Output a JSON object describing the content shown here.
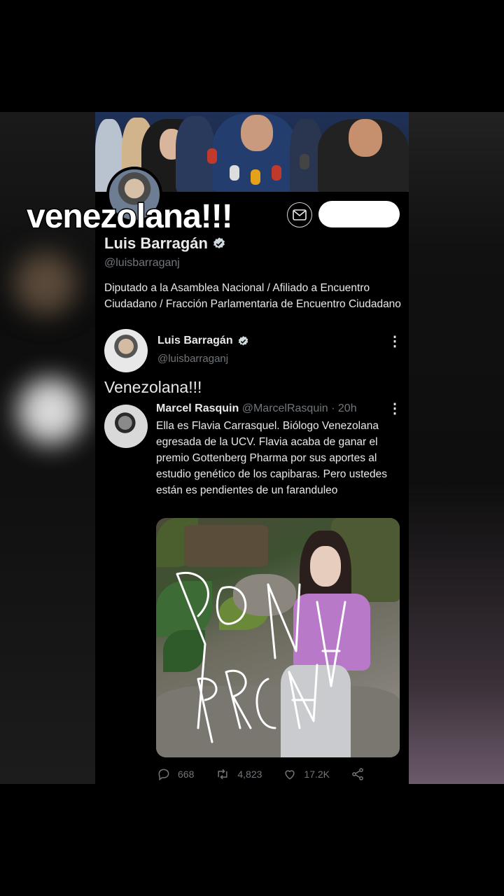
{
  "overlay": {
    "caption": "venezolana!!!"
  },
  "profile": {
    "name": "Luis Barragán",
    "handle": "@luisbarraganj",
    "bio": "Diputado a la Asamblea Nacional / Afiliado a Encuentro Ciudadano /  Fracción Parlamentaria de Encuentro Ciudadano",
    "follow_label": ""
  },
  "tweet": {
    "author_name": "Luis Barragán",
    "author_handle": "@luisbarraganj",
    "text": "Venezolana!!!",
    "more_icon": "more-dots-icon"
  },
  "quoted": {
    "author_name": "Marcel Rasquin",
    "author_handle": "@MarcelRasquin",
    "time": "· 20h",
    "text": "Ella es Flavia Carrasquel. Biólogo Venezolana egresada de la UCV. Flavia acaba de ganar el premio Gottenberg Pharma por sus aportes al estudio genético de los capibaras. Pero ustedes están es pendientes de un faranduleo"
  },
  "actions": {
    "replies": "668",
    "retweets": "4,823",
    "likes": "17.2K"
  },
  "colors": {
    "background": "#000000",
    "text": "#e7e9ea",
    "muted": "#71767b",
    "verified": "#cfd9de"
  }
}
